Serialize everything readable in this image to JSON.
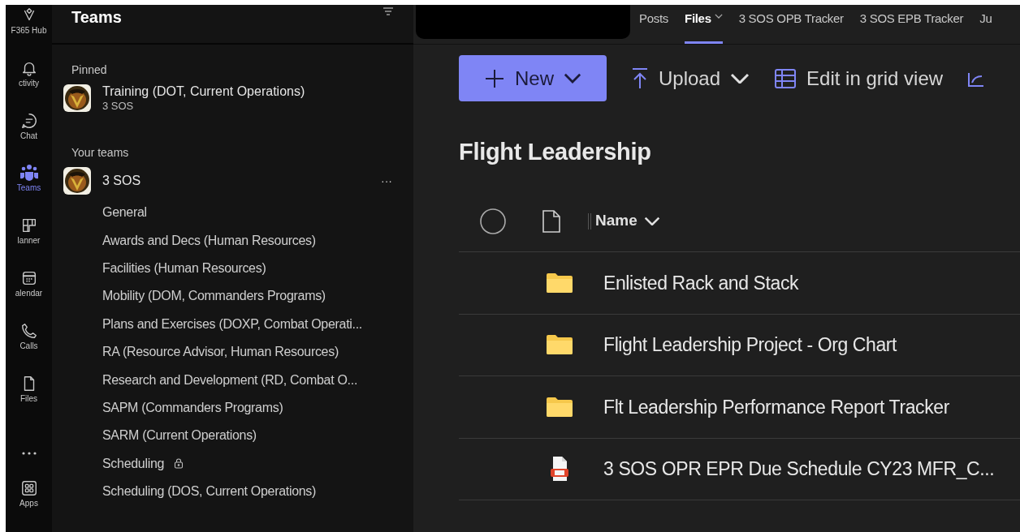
{
  "rail": [
    {
      "label": "F365 Hub",
      "selected": false
    },
    {
      "label": "ctivity",
      "selected": false
    },
    {
      "label": "Chat",
      "selected": false
    },
    {
      "label": "Teams",
      "selected": true
    },
    {
      "label": "lanner",
      "selected": false
    },
    {
      "label": "alendar",
      "selected": false
    },
    {
      "label": "Calls",
      "selected": false
    },
    {
      "label": "Files",
      "selected": false
    },
    {
      "selected": false
    },
    {
      "label": "Apps",
      "selected": false
    }
  ],
  "panel": {
    "title": "Teams",
    "pinned": {
      "heading": "Pinned",
      "items": [
        {
          "name": "Training (DOT, Current Operations)",
          "team": "3 SOS"
        }
      ]
    },
    "your_teams": {
      "heading": "Your teams",
      "team": {
        "name": "3 SOS",
        "more": "···"
      },
      "channels": [
        {
          "name": "General",
          "locked": false
        },
        {
          "name": "Awards and Decs (Human Resources)",
          "locked": false
        },
        {
          "name": "Facilities (Human Resources)",
          "locked": false
        },
        {
          "name": "Mobility (DOM, Commanders Programs)",
          "locked": false
        },
        {
          "name": "Plans and Exercises (DOXP, Combat Operati...",
          "locked": false
        },
        {
          "name": "RA (Resource Advisor, Human Resources)",
          "locked": false
        },
        {
          "name": "Research and Development (RD, Combat O...",
          "locked": false
        },
        {
          "name": "SAPM (Commanders Programs)",
          "locked": false
        },
        {
          "name": "SARM (Current Operations)",
          "locked": false
        },
        {
          "name": "Scheduling",
          "locked": true
        },
        {
          "name": "Scheduling (DOS, Current Operations)",
          "locked": false
        }
      ]
    }
  },
  "tabs": [
    {
      "label": "Posts",
      "selected": false,
      "dropdown": false
    },
    {
      "label": "Files",
      "selected": true,
      "dropdown": true
    },
    {
      "label": "3 SOS OPB Tracker",
      "selected": false,
      "dropdown": false
    },
    {
      "label": "3 SOS EPB Tracker",
      "selected": false,
      "dropdown": false
    },
    {
      "label": "Ju",
      "selected": false,
      "dropdown": false
    }
  ],
  "toolbar": {
    "new": "New",
    "upload": "Upload",
    "grid": "Edit in grid view"
  },
  "folder_title": "Flight Leadership",
  "table": {
    "column": "Name",
    "all_selected": false,
    "rows": [
      {
        "name": "Enlisted Rack and Stack",
        "kind": "folder"
      },
      {
        "name": "Flight Leadership Project - Org Chart",
        "kind": "folder"
      },
      {
        "name": "Flt Leadership Performance Report Tracker",
        "kind": "folder"
      },
      {
        "name": "3 SOS OPR  EPR Due Schedule CY23 MFR_C...",
        "kind": "pdf"
      }
    ]
  }
}
